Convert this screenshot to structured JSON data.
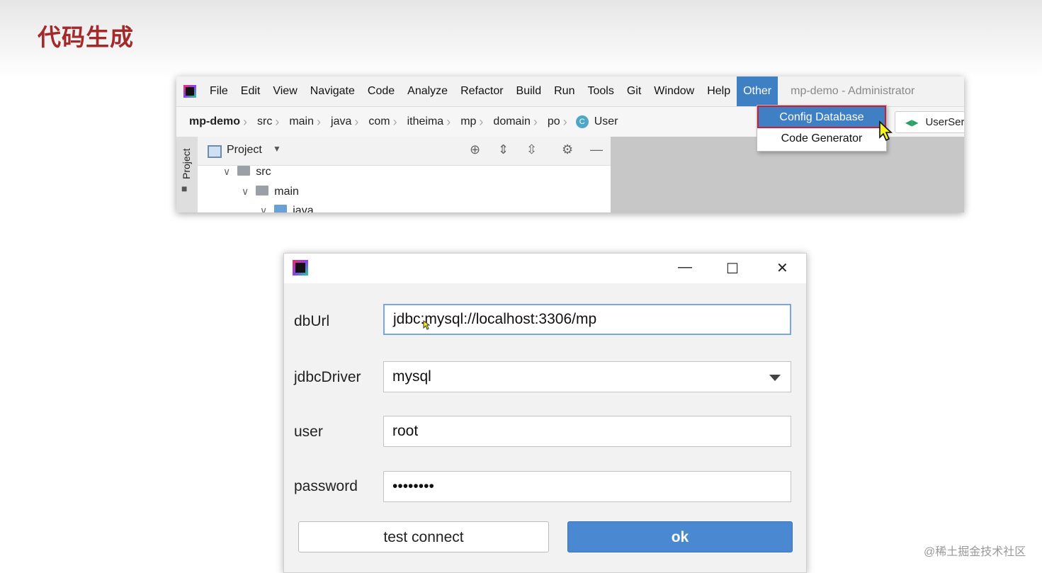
{
  "slide": {
    "title": "代码生成"
  },
  "ide": {
    "menu": [
      "File",
      "Edit",
      "View",
      "Navigate",
      "Code",
      "Analyze",
      "Refactor",
      "Build",
      "Run",
      "Tools",
      "Git",
      "Window",
      "Help",
      "Other"
    ],
    "active_menu": "Other",
    "window_title": "mp-demo - Administrator",
    "breadcrumbs": [
      "mp-demo",
      "src",
      "main",
      "java",
      "com",
      "itheima",
      "mp",
      "domain",
      "po",
      "User"
    ],
    "class_badge": "C",
    "editor_tab": "UserSer",
    "side_tab": "Project",
    "panel_title": "Project",
    "tree": [
      "src",
      "main",
      "java"
    ],
    "dropdown_items": [
      "Config Database",
      "Code Generator"
    ],
    "selected_dropdown": "Config Database"
  },
  "dialog": {
    "fields": [
      {
        "label": "dbUrl",
        "value": "jdbc:mysql://localhost:3306/mp"
      },
      {
        "label": "jdbcDriver",
        "value": "mysql"
      },
      {
        "label": "user",
        "value": "root"
      },
      {
        "label": "password",
        "value": "••••••••"
      }
    ],
    "test_button": "test connect",
    "ok_button": "ok"
  },
  "watermark": "@稀土掘金技术社区"
}
